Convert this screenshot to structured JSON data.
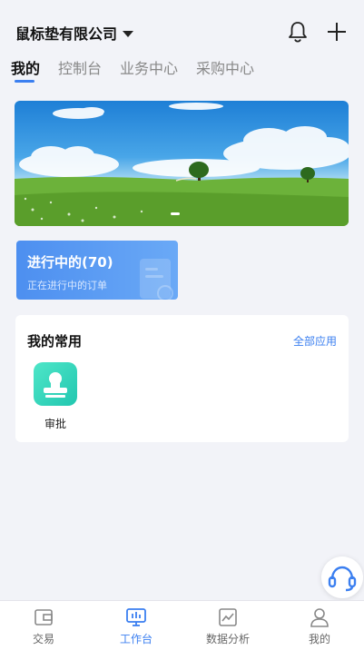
{
  "header": {
    "company": "鼠标垫有限公司",
    "bell_icon": "bell-icon",
    "add_icon": "plus-icon"
  },
  "tabs": [
    {
      "label": "我的",
      "active": true
    },
    {
      "label": "控制台",
      "active": false
    },
    {
      "label": "业务中心",
      "active": false
    },
    {
      "label": "采购中心",
      "active": false
    }
  ],
  "banner": {
    "slides": 1,
    "active_index": 0
  },
  "progress_card": {
    "title": "进行中的(70)",
    "subtitle": "正在进行中的订单"
  },
  "common": {
    "title": "我的常用",
    "all_link": "全部应用",
    "apps": [
      {
        "label": "审批",
        "icon": "approval-stamp-icon"
      }
    ]
  },
  "support_icon": "headset-icon",
  "tabbar": [
    {
      "label": "交易",
      "icon": "wallet-icon",
      "active": false
    },
    {
      "label": "工作台",
      "icon": "workbench-icon",
      "active": true
    },
    {
      "label": "数据分析",
      "icon": "chart-icon",
      "active": false
    },
    {
      "label": "我的",
      "icon": "user-icon",
      "active": false
    }
  ],
  "colors": {
    "accent": "#3b7ff0",
    "card": "#5a9bf3",
    "app_tile": "#2fd6bc"
  }
}
